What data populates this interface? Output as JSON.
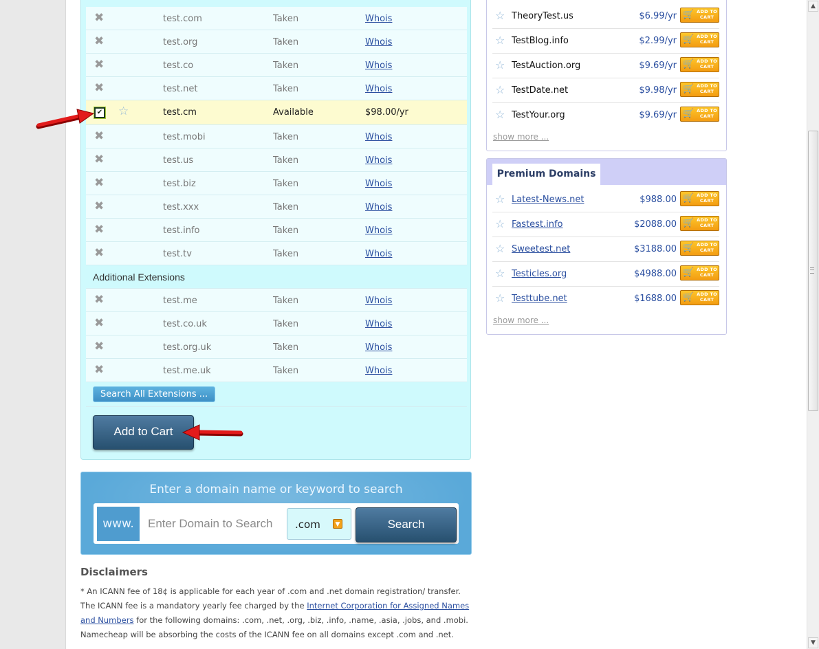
{
  "results": {
    "main_rows": [
      {
        "domain": "test.com",
        "status": "Taken",
        "action": "Whois"
      },
      {
        "domain": "test.org",
        "status": "Taken",
        "action": "Whois"
      },
      {
        "domain": "test.co",
        "status": "Taken",
        "action": "Whois"
      },
      {
        "domain": "test.net",
        "status": "Taken",
        "action": "Whois"
      },
      {
        "domain": "test.cm",
        "status": "Available",
        "price": "$98.00/yr"
      },
      {
        "domain": "test.mobi",
        "status": "Taken",
        "action": "Whois"
      },
      {
        "domain": "test.us",
        "status": "Taken",
        "action": "Whois"
      },
      {
        "domain": "test.biz",
        "status": "Taken",
        "action": "Whois"
      },
      {
        "domain": "test.xxx",
        "status": "Taken",
        "action": "Whois"
      },
      {
        "domain": "test.info",
        "status": "Taken",
        "action": "Whois"
      },
      {
        "domain": "test.tv",
        "status": "Taken",
        "action": "Whois"
      }
    ],
    "additional_heading": "Additional Extensions",
    "additional_rows": [
      {
        "domain": "test.me",
        "status": "Taken",
        "action": "Whois"
      },
      {
        "domain": "test.co.uk",
        "status": "Taken",
        "action": "Whois"
      },
      {
        "domain": "test.org.uk",
        "status": "Taken",
        "action": "Whois"
      },
      {
        "domain": "test.me.uk",
        "status": "Taken",
        "action": "Whois"
      }
    ],
    "search_all_label": "Search All Extensions ...",
    "add_to_cart_label": "Add to Cart"
  },
  "search": {
    "title": "Enter a domain name or keyword to search",
    "prefix": "www.",
    "placeholder": "Enter Domain to Search",
    "tld": ".com",
    "button": "Search"
  },
  "disclaimers": {
    "title": "Disclaimers",
    "text_1": "* An ICANN fee of 18¢ is applicable for each year of .com and .net domain registration/ transfer. The ICANN fee is a mandatory yearly fee charged by the ",
    "link": "Internet Corporation for Assigned Names and Numbers",
    "text_2": " for the following domains: .com, .net, .org, .biz, .info, .name, .asia, .jobs, and .mobi. Namecheap will be absorbing the costs of the ICANN fee on all domains except .com and .net."
  },
  "suggestions": {
    "rows": [
      {
        "name": "TheoryTest.us",
        "price": "$6.99/yr"
      },
      {
        "name": "TestBlog.info",
        "price": "$2.99/yr"
      },
      {
        "name": "TestAuction.org",
        "price": "$9.69/yr"
      },
      {
        "name": "TestDate.net",
        "price": "$9.98/yr"
      },
      {
        "name": "TestYour.org",
        "price": "$9.69/yr"
      }
    ],
    "show_more": "show more ..."
  },
  "premium": {
    "title": "Premium Domains",
    "rows": [
      {
        "name": "Latest-News.net",
        "price": "$988.00"
      },
      {
        "name": "Fastest.info",
        "price": "$2088.00"
      },
      {
        "name": "Sweetest.net",
        "price": "$3188.00"
      },
      {
        "name": "Testicles.org",
        "price": "$4988.00"
      },
      {
        "name": "Testtube.net",
        "price": "$1688.00"
      }
    ],
    "show_more": "show more ..."
  },
  "cart_button_text": "ADD TO CART",
  "icons": {
    "taken": "x-icon",
    "fav": "star-icon",
    "checked": "checkbox-checked-icon",
    "cart": "cart-icon"
  },
  "colors": {
    "accent": "#f39c12",
    "link": "#2b4fa0",
    "results_bg": "#cffafd",
    "available_bg": "#fdfbd0"
  }
}
